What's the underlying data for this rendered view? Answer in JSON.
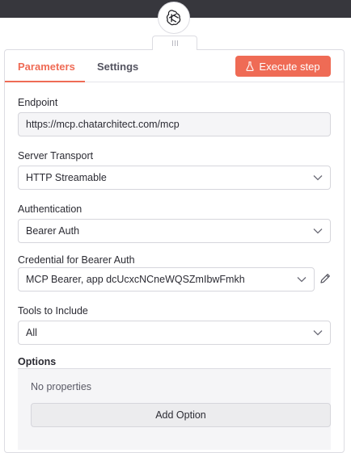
{
  "node": {
    "logo_icon": "openai-logo-icon"
  },
  "tabs": [
    {
      "label": "Parameters",
      "active": true
    },
    {
      "label": "Settings",
      "active": false
    }
  ],
  "execute_button": {
    "label": "Execute step",
    "icon": "flask-icon",
    "color": "#ef6b55"
  },
  "fields": {
    "endpoint": {
      "label": "Endpoint",
      "value": "https://mcp.chatarchitect.com/mcp"
    },
    "server_transport": {
      "label": "Server Transport",
      "value": "HTTP Streamable"
    },
    "authentication": {
      "label": "Authentication",
      "value": "Bearer Auth"
    },
    "credential": {
      "label": "Credential for Bearer Auth",
      "value": "MCP Bearer, app dcUcxcNCneWQSZmIbwFmkh"
    },
    "tools": {
      "label": "Tools to Include",
      "value": "All"
    }
  },
  "options": {
    "label": "Options",
    "empty_text": "No properties",
    "add_button": "Add Option"
  },
  "colors": {
    "accent": "#ef6b55",
    "topbar": "#37373d"
  }
}
